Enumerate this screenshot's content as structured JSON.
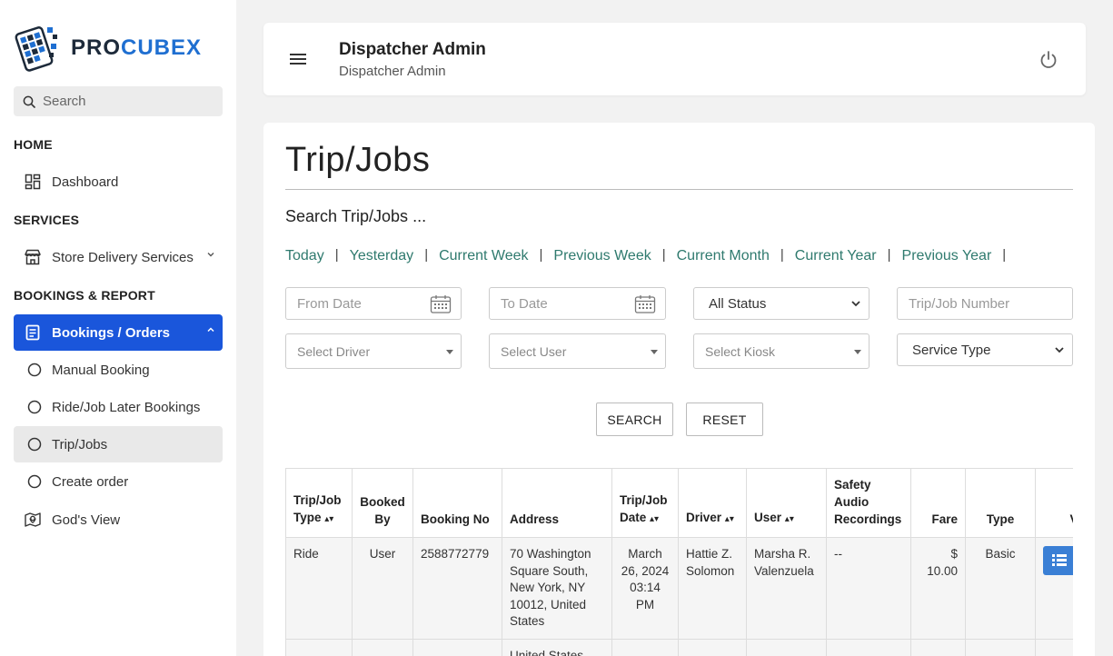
{
  "brand": {
    "name_part1": "PRO",
    "name_part2": "CUBEX"
  },
  "search": {
    "placeholder": "Search"
  },
  "sidebar": {
    "sections": [
      "HOME",
      "SERVICES",
      "BOOKINGS & REPORT"
    ],
    "items": [
      {
        "label": "Dashboard",
        "icon": "dashboard-icon"
      },
      {
        "label": "Store Delivery Services",
        "icon": "store-icon"
      },
      {
        "label": "Bookings / Orders",
        "icon": "document-icon"
      },
      {
        "label": "Manual Booking",
        "icon": "circle-icon"
      },
      {
        "label": "Ride/Job Later Bookings",
        "icon": "circle-icon"
      },
      {
        "label": "Trip/Jobs",
        "icon": "circle-icon"
      },
      {
        "label": "Create order",
        "icon": "circle-icon"
      },
      {
        "label": "God's View",
        "icon": "map-pin-icon"
      }
    ]
  },
  "header": {
    "title": "Dispatcher Admin",
    "subtitle": "Dispatcher Admin"
  },
  "page": {
    "title": "Trip/Jobs",
    "search_heading": "Search Trip/Jobs ...",
    "quick_links": [
      "Today",
      "Yesterday",
      "Current Week",
      "Previous Week",
      "Current Month",
      "Current Year",
      "Previous Year"
    ],
    "filters": {
      "from_date": "From Date",
      "to_date": "To Date",
      "status": "All Status",
      "job_number": "Trip/Job Number",
      "driver": "Select Driver",
      "user": "Select User",
      "kiosk": "Select Kiosk",
      "service_type": "Service Type"
    },
    "buttons": {
      "search": "SEARCH",
      "reset": "RESET"
    }
  },
  "table": {
    "headers": {
      "type": "Trip/Job Type",
      "booked_by": "Booked By",
      "booking_no": "Booking No",
      "address": "Address",
      "date": "Trip/Job Date",
      "driver": "Driver",
      "user": "User",
      "safety": "Safety Audio Recordings",
      "fare": "Fare",
      "ftype": "Type",
      "view": "V"
    },
    "rows": [
      {
        "type": "Ride",
        "booked_by": "User",
        "booking_no": "2588772779",
        "address": "70 Washington Square South, New York, NY 10012, United States",
        "date": "March 26, 2024 03:14 PM",
        "driver": "Hattie Z. Solomon",
        "user": "Marsha R. Valenzuela",
        "safety": "--",
        "fare": "$ 10.00",
        "ftype": "Basic"
      },
      {
        "address": "United States"
      }
    ]
  }
}
